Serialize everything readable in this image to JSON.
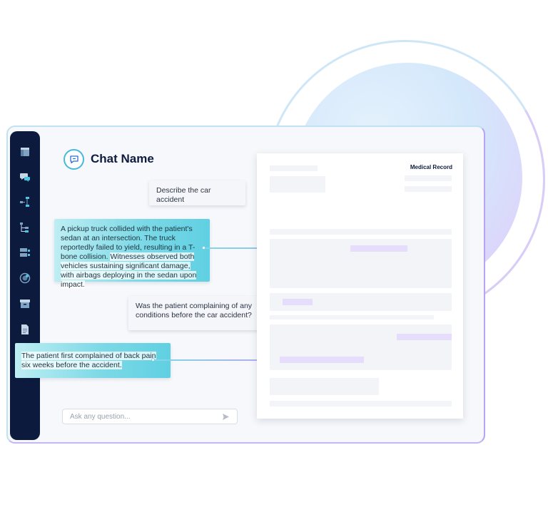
{
  "sidebar": {
    "icons": [
      "dashboard-icon",
      "chat-icon",
      "workflow-icon",
      "hierarchy-icon",
      "layout-icon",
      "target-icon",
      "archive-icon",
      "document-icon"
    ]
  },
  "chat": {
    "title": "Chat Name",
    "messages": [
      {
        "role": "user",
        "text": "Describe the car accident"
      },
      {
        "role": "assistant",
        "text": "A pickup truck collided with the patient's sedan at an intersection. The truck reportedly failed to yield, resulting in a T-bone collision.",
        "highlight": "Witnesses observed both vehicles sustaining significant damage, with airbags deploying in the sedan upon impact."
      },
      {
        "role": "user",
        "text": "Was the patient complaining of any conditions before the car accident?"
      },
      {
        "role": "assistant",
        "text": "",
        "highlight": "The patient first complained of back pain six weeks before the accident."
      }
    ],
    "input_placeholder": "Ask any question..."
  },
  "document": {
    "title": "Medical Record"
  },
  "colors": {
    "sidebar": "#0b1a3d",
    "accent_cyan": "#5fd0e2",
    "accent_purple": "#b9a4f3"
  }
}
